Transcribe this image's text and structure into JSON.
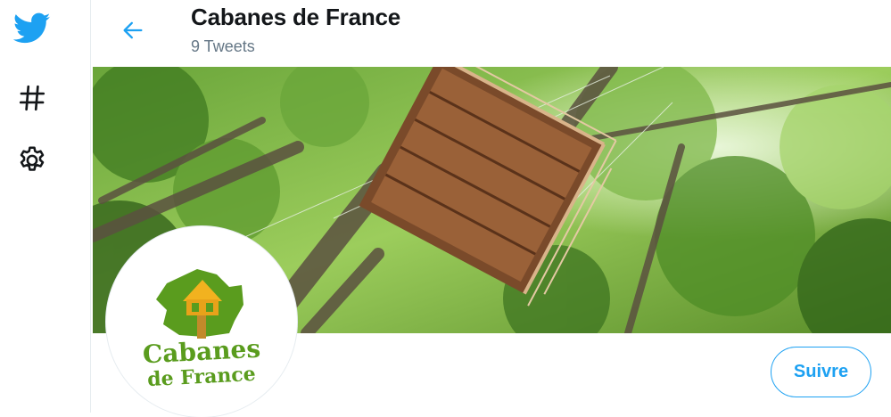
{
  "profile": {
    "name": "Cabanes de France",
    "tweet_count": "9 Tweets",
    "logo_line1": "Cabanes",
    "logo_line2": "de France"
  },
  "actions": {
    "follow_label": "Suivre"
  },
  "icons": {
    "logo": "twitter-bird-icon",
    "explore": "hashtag-icon",
    "settings": "gear-icon",
    "back": "back-arrow-icon"
  },
  "colors": {
    "accent": "#1da1f2",
    "text": "#14171a",
    "secondary": "#657786",
    "logo_green": "#5a9c1e",
    "logo_orange": "#e8a21a"
  }
}
